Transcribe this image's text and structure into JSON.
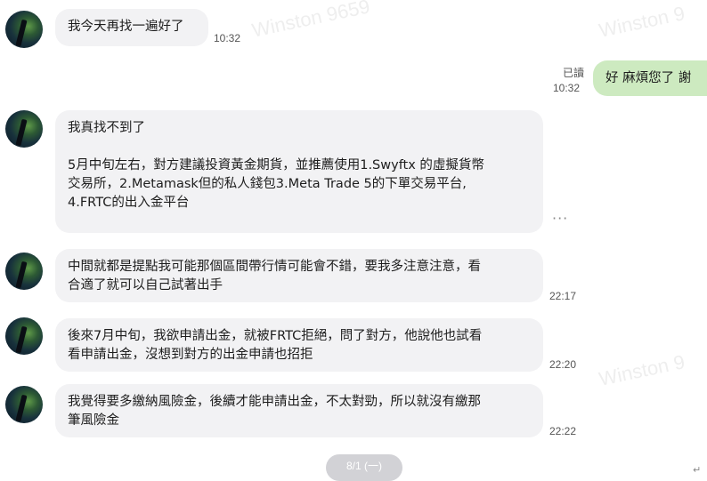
{
  "watermarks": [
    "Winston 9659",
    "Winston 9",
    "Winston 9659",
    "Winston 9659",
    "Winston 9"
  ],
  "outgoing": {
    "read_label": "已讀",
    "time": "10:32",
    "text": "好 麻煩您了 謝"
  },
  "messages": [
    {
      "text": "我今天再找一遍好了",
      "time": "10:32"
    },
    {
      "text": "我真找不到了\n\n5月中旬左右，對方建議投資黃金期貨，並推薦使用1.Swyftx 的虛擬貨幣\n交易所，2.Metamask但的私人錢包3.Meta Trade 5的下單交易平台,\n4.FRTC的出入金平台",
      "time": ""
    },
    {
      "text": "中間就都是提點我可能那個區間帶行情可能會不錯，要我多注意注意，看\n合適了就可以自己試著出手",
      "time": "22:17"
    },
    {
      "text": "後來7月中旬，我欲申請出金，就被FRTC拒絕，問了對方，他說他也試看\n看申請出金，沒想到對方的出金申請也招拒",
      "time": "22:20"
    },
    {
      "text": "我覺得要多繳納風險金，後續才能申請出金，不太對勁，所以就沒有繳那\n筆風險金",
      "time": "22:22"
    }
  ],
  "more_icon": "···",
  "pager_label": "8/1 (一)",
  "return_mark": "↵"
}
